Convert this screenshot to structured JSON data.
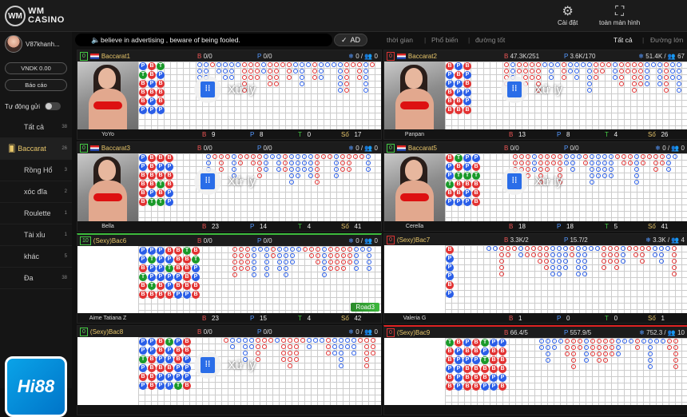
{
  "header": {
    "logo_mark": "WM",
    "logo_line1": "WM",
    "logo_line2": "CASINO",
    "settings_label": "Cài đặt",
    "fullscreen_label": "toàn màn hình"
  },
  "sidebar": {
    "username": "V87khanh...",
    "balance": "VNDK 0.00",
    "report_label": "Báo cáo",
    "autosend_label": "Tự động gửi",
    "items": [
      {
        "label": "Tất cả",
        "count": "38"
      },
      {
        "label": "Baccarat",
        "count": "26"
      },
      {
        "label": "Rồng Hổ",
        "count": "3"
      },
      {
        "label": "xóc đĩa",
        "count": "2"
      },
      {
        "label": "Roulette",
        "count": "1"
      },
      {
        "label": "Tài xỉu",
        "count": "1"
      },
      {
        "label": "khác",
        "count": "5"
      },
      {
        "label": "Đa",
        "count": "38"
      }
    ],
    "banner": "Hi88"
  },
  "notice": "believe in advertising , beware of being fooled.",
  "ad_label": "AD",
  "filters": {
    "f1": "thời gian",
    "f2": "Phổ biến",
    "f3": "đường tốt",
    "f4": "Tất cả",
    "f5": "Đường lớn"
  },
  "overlay_label": "Xử lý",
  "road3_label": "Road3",
  "tables": [
    {
      "num": "0",
      "name": "Baccarat1",
      "hb": "0/0",
      "hp": "0/0",
      "r1": "0",
      "r2": "0",
      "dealer": "YoYo",
      "b": "9",
      "p": "8",
      "t": "0",
      "so": "17"
    },
    {
      "num": "0",
      "name": "Baccarat2",
      "hb": "47.3K/251",
      "hp": "3.6K/170",
      "r1": "51.4K",
      "r2": "67",
      "dealer": "Panpan",
      "b": "13",
      "p": "8",
      "t": "4",
      "so": "26"
    },
    {
      "num": "0",
      "name": "Baccarat3",
      "hb": "0/0",
      "hp": "0/0",
      "r1": "0",
      "r2": "0",
      "dealer": "Bella",
      "b": "23",
      "p": "14",
      "t": "4",
      "so": "41"
    },
    {
      "num": "0",
      "name": "Baccarat5",
      "hb": "0/0",
      "hp": "0/0",
      "r1": "0",
      "r2": "0",
      "dealer": "Cerella",
      "b": "18",
      "p": "18",
      "t": "5",
      "so": "41"
    },
    {
      "num": "10",
      "name": "(Sexy)Bac6",
      "hb": "0/0",
      "hp": "0/0",
      "r1": "0",
      "r2": "0",
      "dealer": "Aime Tatiana Z",
      "b": "23",
      "p": "15",
      "t": "4",
      "so": "42"
    },
    {
      "num": "0",
      "name": "(Sexy)Bac7",
      "hb": "3.3K/2",
      "hp": "15.7/2",
      "r1": "3.3K",
      "r2": "4",
      "dealer": "Valeria G",
      "b": "1",
      "p": "0",
      "t": "0",
      "so": "1"
    },
    {
      "num": "0",
      "name": "(Sexy)Bac8",
      "hb": "0/0",
      "hp": "0/0",
      "r1": "0",
      "r2": "0",
      "dealer": "",
      "b": "",
      "p": "",
      "t": "",
      "so": ""
    },
    {
      "num": "0",
      "name": "(Sexy)Bac9",
      "hb": "66.4/5",
      "hp": "557.9/5",
      "r1": "752.3",
      "r2": "10",
      "dealer": "",
      "b": "",
      "p": "",
      "t": "",
      "so": ""
    }
  ],
  "letters": {
    "b": "B",
    "p": "P",
    "t": "T",
    "so": "Số",
    "slash": "/"
  }
}
